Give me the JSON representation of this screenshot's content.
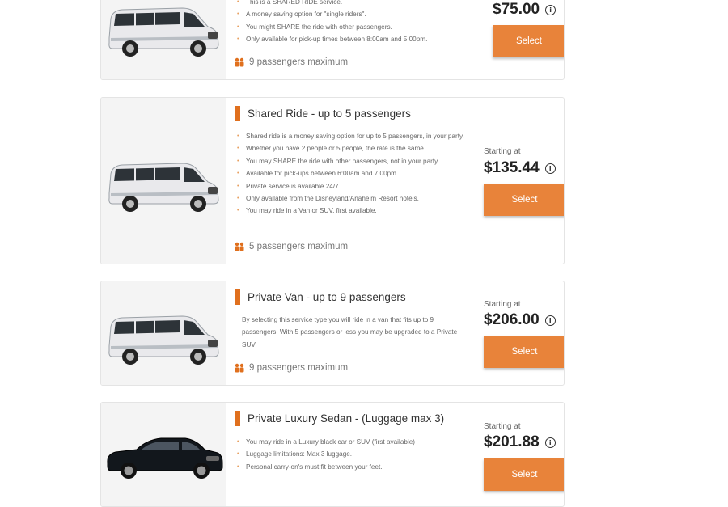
{
  "accent_color": "#e8833a",
  "cards": [
    {
      "features": [
        "This is a SHARED RIDE service.",
        "A money saving option for \"single riders\".",
        "You might SHARE the ride with other passengers.",
        "Only available for pick-up times between 8:00am and 5:00pm."
      ],
      "pax": "9 passengers maximum",
      "price": "$75.00",
      "select": "Select",
      "image": "van-white"
    },
    {
      "title": "Shared Ride - up to 5 passengers",
      "features": [
        "Shared ride is a money saving option for up to 5 passengers, in your party.",
        "Whether you have 2 people or 5 people, the rate is the same.",
        "You may SHARE the ride with other passengers, not in your party.",
        "Available for pick-ups between 6:00am and 7:00pm.",
        "Private service is available 24/7.",
        "Only available from the Disneyland/Anaheim Resort hotels.",
        "You may ride in a Van or SUV, first available."
      ],
      "pax": "5 passengers maximum",
      "starting": "Starting at",
      "price": "$135.44",
      "select": "Select",
      "image": "van-white"
    },
    {
      "title": "Private Van - up to 9 passengers",
      "description": "By selecting this service type you will ride in a van that fits up to 9 passengers. With 5 passengers or less you may be upgraded to a Private SUV",
      "pax": "9 passengers maximum",
      "starting": "Starting at",
      "price": "$206.00",
      "select": "Select",
      "image": "van-white"
    },
    {
      "title": "Private Luxury Sedan - (Luggage max 3)",
      "features": [
        "You may ride in a Luxury black car or SUV (first available)",
        "Luggage limitations: Max 3 luggage.",
        "Personal carry-on's must fit between your feet."
      ],
      "starting": "Starting at",
      "price": "$201.88",
      "select": "Select",
      "image": "sedan-black"
    }
  ]
}
